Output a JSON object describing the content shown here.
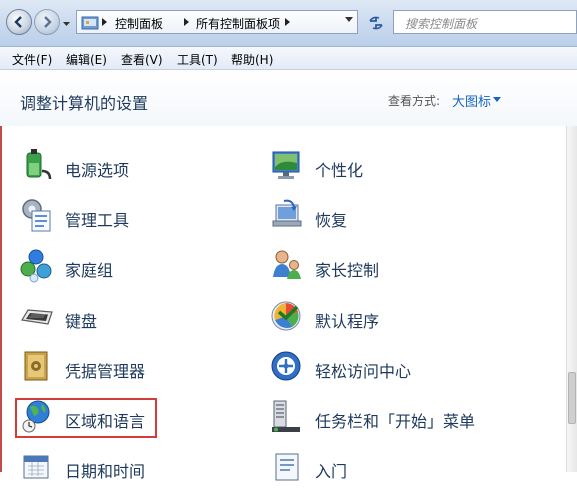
{
  "breadcrumb": [
    "控制面板",
    "所有控制面板项"
  ],
  "search": {
    "placeholder": "搜索控制面板"
  },
  "menu": [
    "文件(F)",
    "编辑(E)",
    "查看(V)",
    "工具(T)",
    "帮助(H)"
  ],
  "header": {
    "title": "调整计算机的设置",
    "view_label": "查看方式:",
    "view_value": "大图标"
  },
  "items": {
    "left": [
      {
        "label": "电源选项",
        "icon": "power-options-icon"
      },
      {
        "label": "管理工具",
        "icon": "admin-tools-icon"
      },
      {
        "label": "家庭组",
        "icon": "homegroup-icon"
      },
      {
        "label": "键盘",
        "icon": "keyboard-icon"
      },
      {
        "label": "凭据管理器",
        "icon": "credential-manager-icon"
      },
      {
        "label": "区域和语言",
        "icon": "region-language-icon",
        "highlighted": true
      },
      {
        "label": "日期和时间",
        "icon": "date-time-icon"
      }
    ],
    "right": [
      {
        "label": "个性化",
        "icon": "personalization-icon"
      },
      {
        "label": "恢复",
        "icon": "recovery-icon"
      },
      {
        "label": "家长控制",
        "icon": "parental-controls-icon"
      },
      {
        "label": "默认程序",
        "icon": "default-programs-icon"
      },
      {
        "label": "轻松访问中心",
        "icon": "ease-of-access-icon"
      },
      {
        "label": "任务栏和「开始」菜单",
        "icon": "taskbar-start-menu-icon"
      },
      {
        "label": "入门",
        "icon": "getting-started-icon"
      }
    ]
  },
  "colors": {
    "link_text": "#1e395b",
    "view_value": "#1565c0",
    "highlight_border": "#d63b3b"
  }
}
